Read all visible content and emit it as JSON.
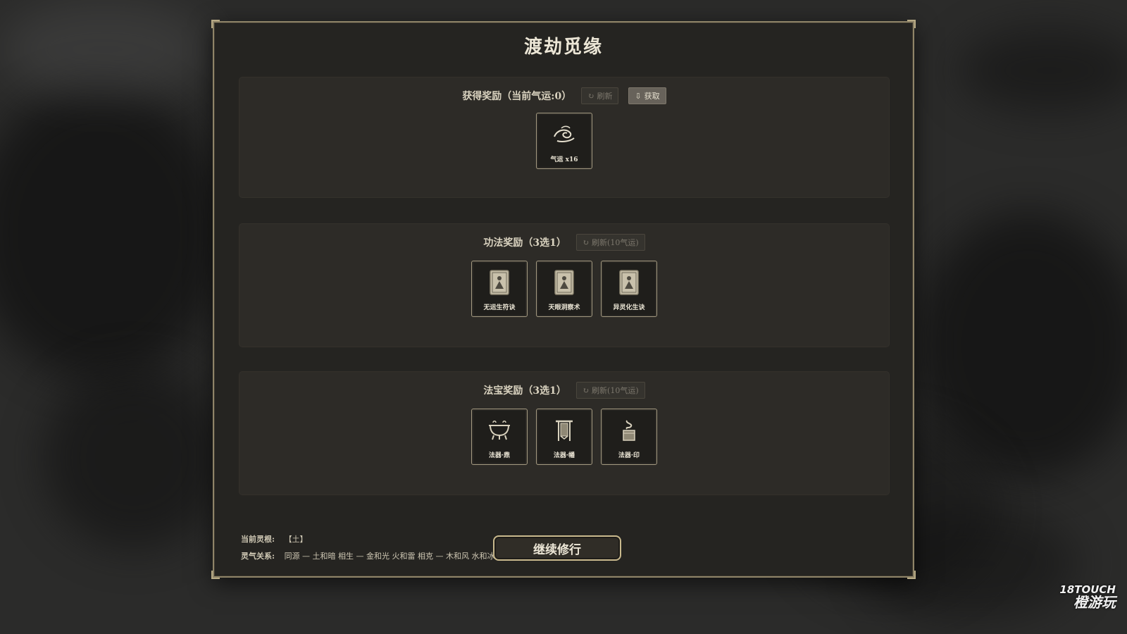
{
  "dialog": {
    "title": "渡劫觅缘",
    "continue_label": "继续修行"
  },
  "reward_section": {
    "label": "获得奖励（当前气运:0）",
    "refresh_label": "刷新",
    "claim_label": "获取",
    "items": [
      {
        "caption": "气运 x16",
        "icon": "cloud-swirl-icon"
      }
    ]
  },
  "technique_section": {
    "label": "功法奖励（3选1）",
    "refresh_label": "刷新(10气运)",
    "items": [
      {
        "caption": "无运生符诀",
        "icon": "meditating-figure-icon"
      },
      {
        "caption": "天眼洞察术",
        "icon": "meditating-figure-icon"
      },
      {
        "caption": "异灵化生诀",
        "icon": "meditating-figure-icon"
      }
    ]
  },
  "treasure_section": {
    "label": "法宝奖励（3选1）",
    "refresh_label": "刷新(10气运)",
    "items": [
      {
        "caption": "法器·鼎",
        "icon": "cauldron-icon"
      },
      {
        "caption": "法器·幡",
        "icon": "banner-icon"
      },
      {
        "caption": "法器·印",
        "icon": "seal-icon"
      }
    ]
  },
  "footer": {
    "root_key": "当前灵根:",
    "root_value": "【土】",
    "relation_key": "灵气关系:",
    "relation_value": "同源 — 土和暗  相生 — 金和光 火和雷  相克 — 木和风 水和冰"
  },
  "watermark": {
    "line1": "18TOUCH",
    "line2": "橙游玩"
  }
}
